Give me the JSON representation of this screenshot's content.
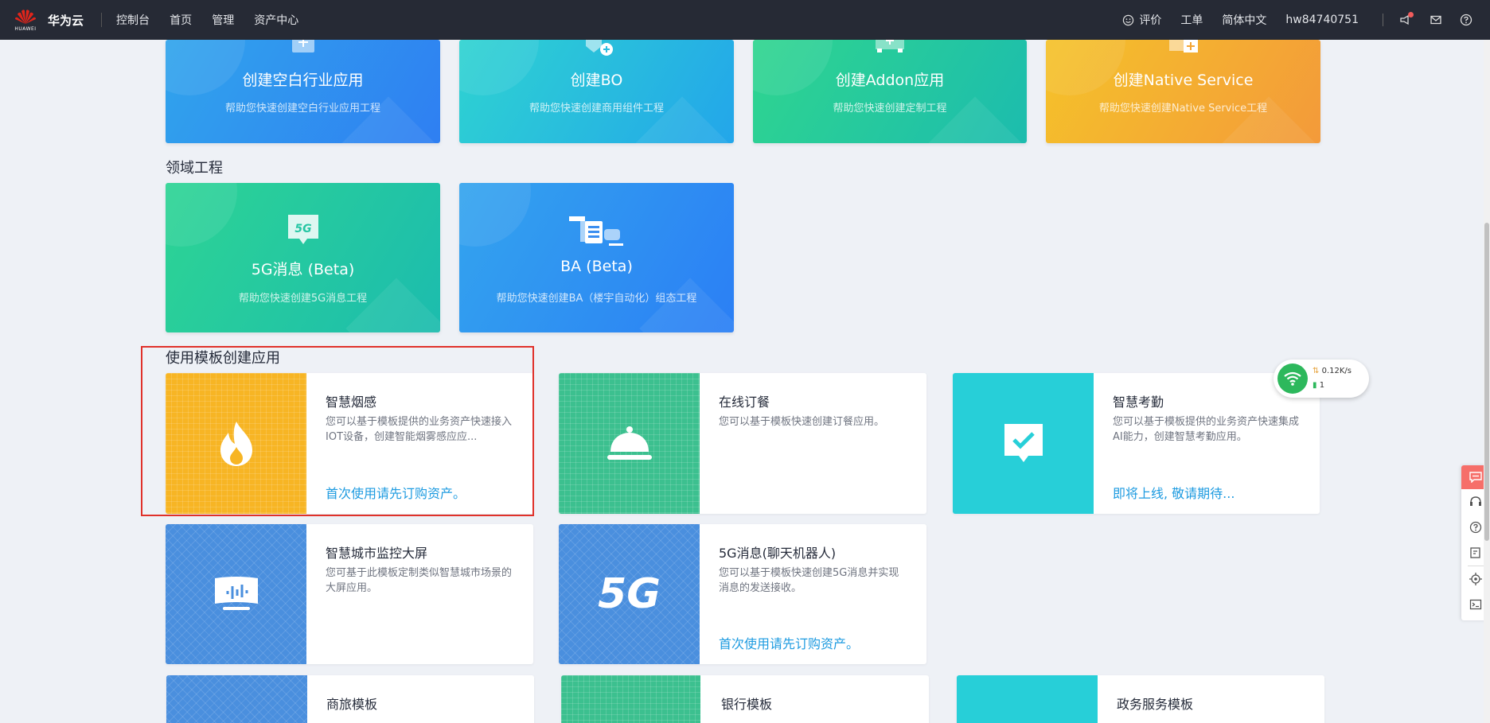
{
  "topbar": {
    "logo_text": "HUAWEI",
    "brand": "华为云",
    "nav": [
      "控制台",
      "首页",
      "管理",
      "资产中心"
    ],
    "rating": "评价",
    "ticket": "工单",
    "language": "简体中文",
    "user": "hw84740751"
  },
  "create_cards": [
    {
      "title": "创建空白行业应用",
      "desc": "帮助您快速创建空白行业应用工程"
    },
    {
      "title": "创建BO",
      "desc": "帮助您快速创建商用组件工程"
    },
    {
      "title": "创建Addon应用",
      "desc": "帮助您快速创建定制工程"
    },
    {
      "title": "创建Native Service",
      "desc": "帮助您快速创建Native Service工程"
    }
  ],
  "domain_section": {
    "title": "领域工程",
    "cards": [
      {
        "title": "5G消息 (Beta)",
        "desc": "帮助您快速创建5G消息工程",
        "badge": "5G"
      },
      {
        "title": "BA (Beta)",
        "desc": "帮助您快速创建BA（楼宇自动化）组态工程"
      }
    ]
  },
  "template_section": {
    "title": "使用模板创建应用",
    "cards": [
      {
        "name": "智慧烟感",
        "desc": "您可以基于模板提供的业务资产快速接入IOT设备，创建智能烟雾感应应...",
        "link": "首次使用请先订购资产。"
      },
      {
        "name": "在线订餐",
        "desc": "您可以基于模板快速创建订餐应用。",
        "link": ""
      },
      {
        "name": "智慧考勤",
        "desc": "您可以基于模板提供的业务资产快速集成AI能力，创建智慧考勤应用。",
        "link": "即将上线, 敬请期待..."
      },
      {
        "name": "智慧城市监控大屏",
        "desc": "您可基于此模板定制类似智慧城市场景的大屏应用。",
        "link": ""
      },
      {
        "name": "5G消息(聊天机器人)",
        "desc": "您可以基于模板快速创建5G消息并实现消息的发送接收。",
        "link": "首次使用请先订购资产。",
        "thumb_text": "5G"
      },
      {
        "name": "商旅模板",
        "desc": "",
        "link": ""
      },
      {
        "name": "银行模板",
        "desc": "",
        "link": ""
      },
      {
        "name": "政务服务模板",
        "desc": "",
        "link": ""
      }
    ]
  },
  "network_widget": {
    "speed": "0.12K/s",
    "count": "1"
  },
  "colors": {
    "topbar": "#262a35",
    "link": "#1e9be0",
    "highlight": "#e0312a",
    "orange_thumb": "#f7b524",
    "green_thumb": "#3cc08f",
    "cyan_thumb": "#27cfd8",
    "blue_thumb": "#4a8fde"
  }
}
